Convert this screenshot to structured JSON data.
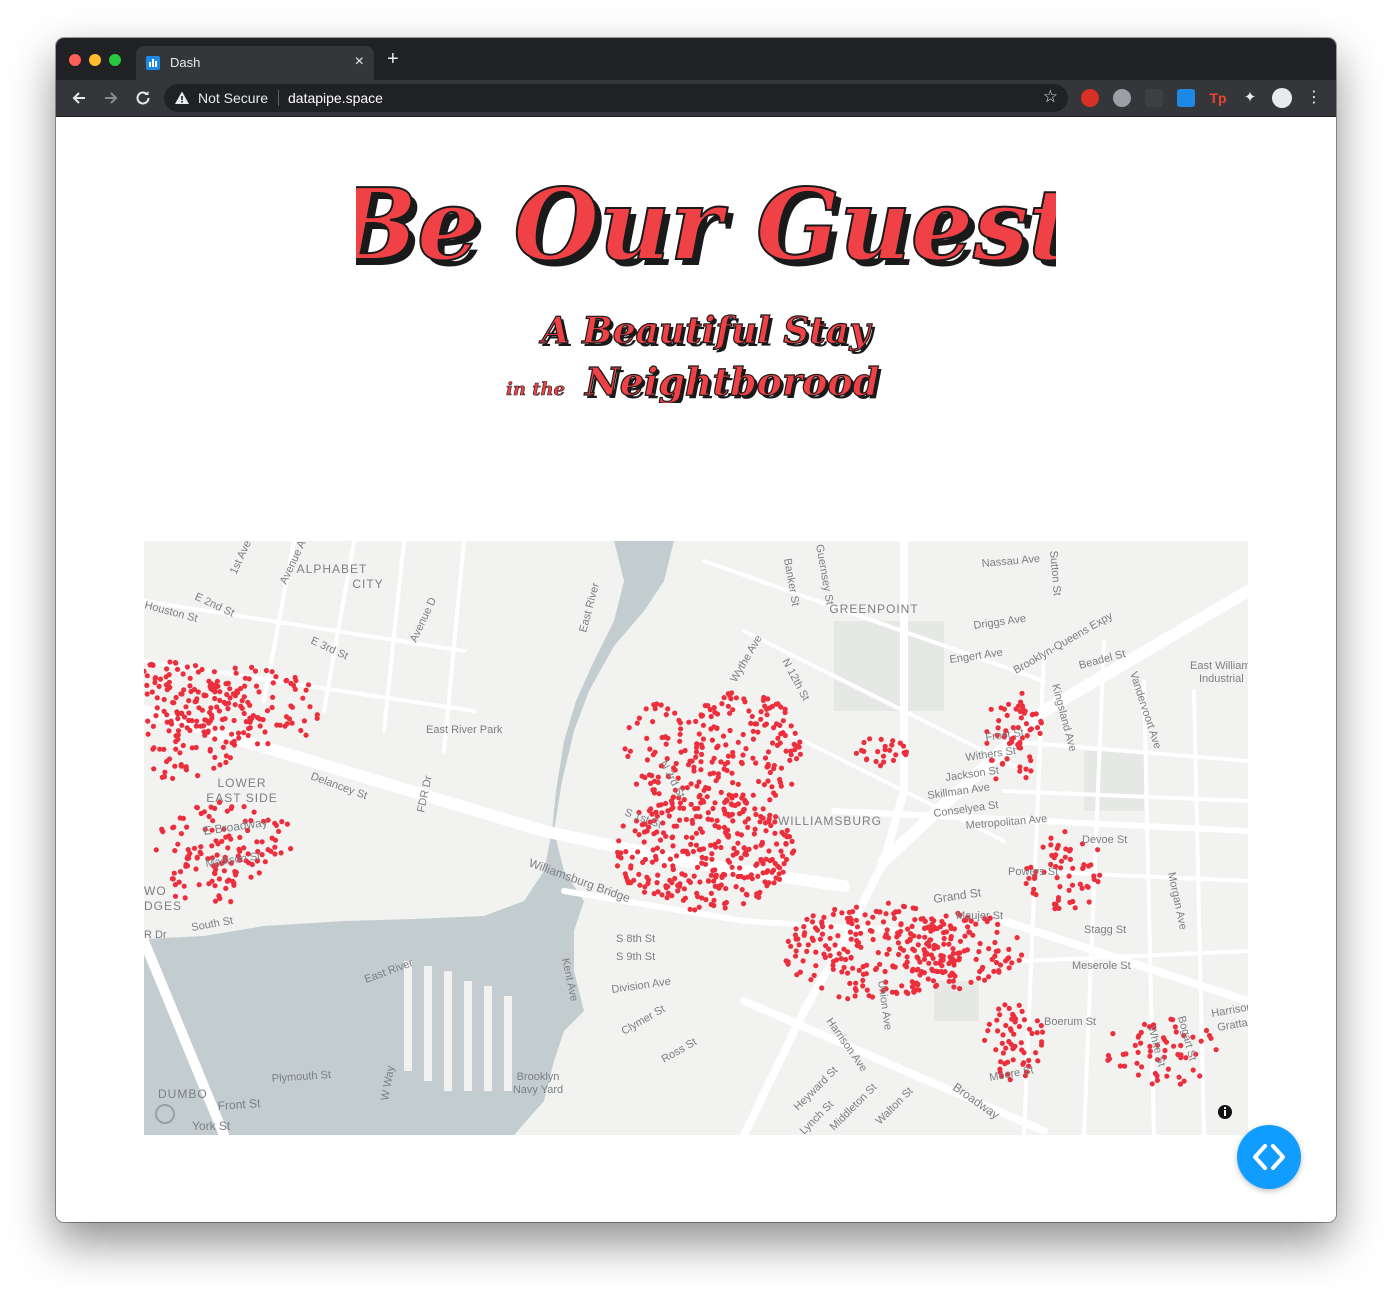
{
  "browser": {
    "tab_title": "Dash",
    "tab_close_glyph": "×",
    "new_tab_glyph": "+",
    "security_label": "Not Secure",
    "url": "datapipe.space",
    "icons": [
      "back-icon",
      "forward-icon",
      "reload-icon",
      "warning-icon",
      "star-icon",
      "extension-icon",
      "profile-avatar",
      "menu-icon"
    ]
  },
  "header": {
    "title": "Be Our Guest",
    "subtitle_line1": "A Beautiful Stay",
    "subtitle_line2_prefix": "in the",
    "subtitle_line2": "Neightborood",
    "title_color": "#ef4146",
    "shadow_color": "#1a1a1a"
  },
  "map": {
    "marker_color": "#ec2f3c",
    "water_color": "#c3cdd0",
    "land_color": "#f2f2f1",
    "labels": {
      "alphabet_city_1": "ALPHABET",
      "alphabet_city_2": "CITY",
      "greenpoint": "GREENPOINT",
      "lower_east_side_1": "LOWER",
      "lower_east_side_2": "EAST SIDE",
      "williamsburg": "WILLIAMSBURG",
      "two_bridges_1": "WO",
      "two_bridges_2": "DGES",
      "dumbo": "DUMBO",
      "east_river_north": "East River",
      "east_river_south": "East River",
      "east_river_park": "East River Park",
      "navy_yard_1": "Brooklyn",
      "navy_yard_2": "Navy Yard",
      "east_williamsburg_1": "East William",
      "east_williamsburg_2": "Industrial",
      "williamsburg_bridge": "Williamsburg Bridge",
      "bqe": "Brooklyn-Queens Expy",
      "fdr": "FDR Dr",
      "fdr_left": "R Dr",
      "houston": "Houston St",
      "e2nd": "E 2nd St",
      "e3rd": "E 3rd St",
      "ave_a": "Avenue A",
      "ave_d": "Avenue D",
      "first_ave": "1st Ave",
      "delancey": "Delancey St",
      "e_broadway": "E Broadway",
      "madison": "Madison St",
      "south_st": "South St",
      "wythe": "Wythe Ave",
      "n12": "N 12th St",
      "n3rd": "N 3rd St",
      "s1st": "S 1st St",
      "s8th": "S 8th St",
      "s9th": "S 9th St",
      "division": "Division Ave",
      "clymer": "Clymer St",
      "ross": "Ross St",
      "kent": "Kent Ave",
      "banker": "Banker St",
      "guernsey": "Guernsey St",
      "nassau": "Nassau Ave",
      "sutton": "Sutton St",
      "driggs": "Driggs Ave",
      "engert": "Engert Ave",
      "beadel": "Beadel St",
      "vandervoort": "Vandervoort Ave",
      "kingsland": "Kingsland Ave",
      "frost": "Frost St",
      "withers": "Withers St",
      "jackson": "Jackson St",
      "skillman": "Skillman Ave",
      "conselyea": "Conselyea St",
      "metropolitan": "Metropolitan Ave",
      "devoe": "Devoe St",
      "powers": "Powers St",
      "grand": "Grand St",
      "maujer": "Maujer St",
      "stagg": "Stagg St",
      "meserole": "Meserole St",
      "boerum": "Boerum St",
      "morgan": "Morgan Ave",
      "union": "Union Ave",
      "harrison": "Harrison Ave",
      "heyward": "Heyward St",
      "lynch": "Lynch St",
      "middleton": "Middleton St",
      "walton": "Walton St",
      "broadway": "Broadway",
      "moore": "Moore St",
      "white": "White St",
      "bogart": "Bogart St",
      "harrison_r": "Harrison",
      "grattan": "Gratta",
      "plymouth": "Plymouth St",
      "front": "Front St",
      "york": "York St",
      "w_way": "W Way",
      "bedford_frag": "Bedford St"
    }
  },
  "fab": {
    "glyph": "‹ ›"
  }
}
